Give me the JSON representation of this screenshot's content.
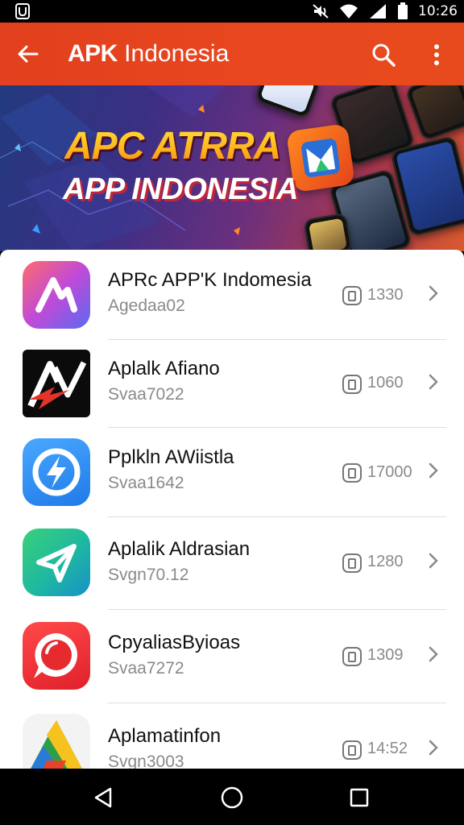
{
  "status_bar": {
    "time": "10:26"
  },
  "app_bar": {
    "title_bold": "APK",
    "title_rest": " Indonesia"
  },
  "banner": {
    "line1": "APC ATRRA",
    "line2": "APP INDONESIA"
  },
  "colors": {
    "accent": "#e6441e",
    "text_primary": "#111111",
    "text_secondary": "#8a8a8a"
  },
  "apps": [
    {
      "name": "APRc APP'K Indomesia",
      "sub": "Agedaa02",
      "count": "1330",
      "icon": "purple-a-logo-icon"
    },
    {
      "name": "Aplalk Afiano",
      "sub": "Svaa7022",
      "count": "1060",
      "icon": "black-av-logo-icon"
    },
    {
      "name": "Pplkln AWiistla",
      "sub": "Svaa1642",
      "count": "17000",
      "icon": "blue-bolt-logo-icon"
    },
    {
      "name": "Aplalik Aldrasian",
      "sub": "Svgn70.12",
      "count": "1280",
      "icon": "green-send-logo-icon"
    },
    {
      "name": "CpyaliasByioas",
      "sub": "Svaa7272",
      "count": "1309",
      "icon": "red-chat-logo-icon"
    },
    {
      "name": "Aplamatinfon",
      "sub": "Svgn3003",
      "count": "14:52",
      "icon": "triangle-logo-icon"
    }
  ]
}
